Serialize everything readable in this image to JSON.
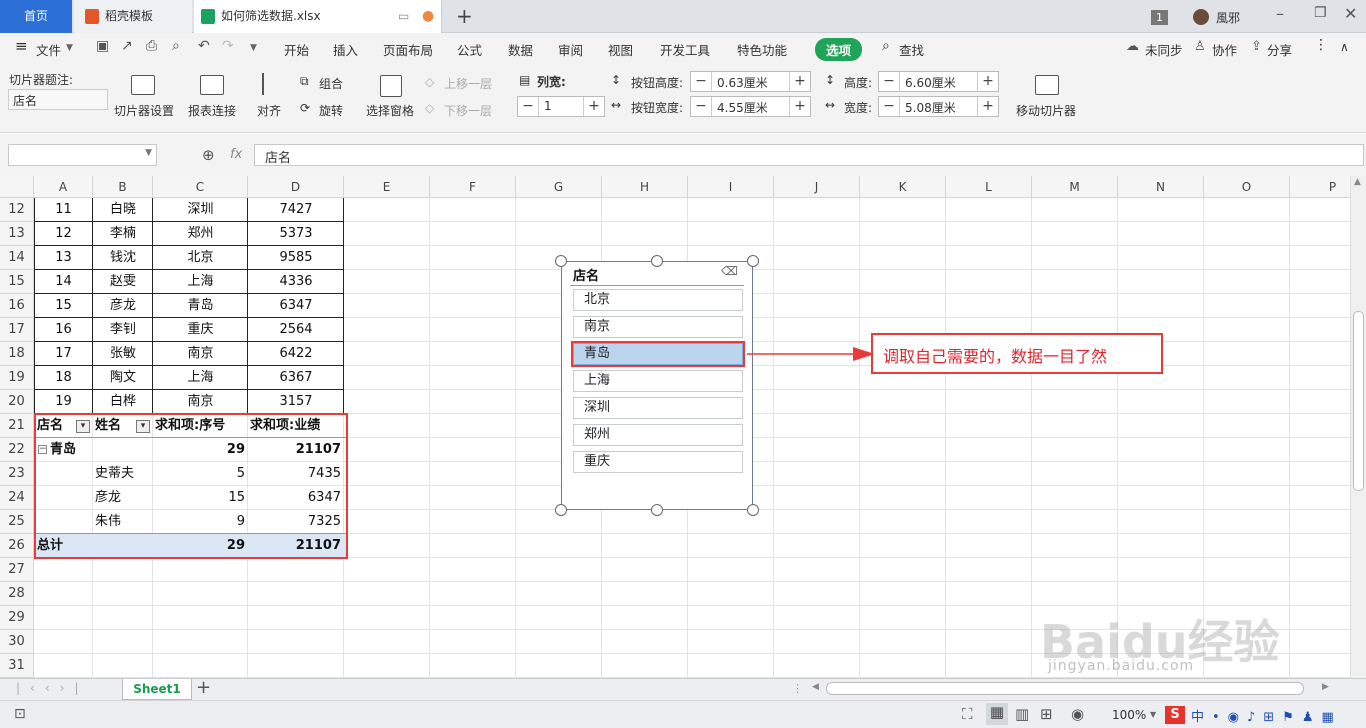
{
  "tabs": {
    "home": "首页",
    "template": "稻壳模板",
    "file": "如何筛选数据.xlsx",
    "badge": "1",
    "user": "風邪"
  },
  "menu": {
    "file": "文件",
    "items": [
      "开始",
      "插入",
      "页面布局",
      "公式",
      "数据",
      "审阅",
      "视图",
      "开发工具",
      "特色功能"
    ],
    "active": "选项",
    "search": "查找",
    "sync": "未同步",
    "collab": "协作",
    "share": "分享"
  },
  "ribbon": {
    "caption_label": "切片器题注:",
    "caption_value": "店名",
    "slicer_settings": "切片器设置",
    "report_conn": "报表连接",
    "align": "对齐",
    "group": "组合",
    "rotate": "旋转",
    "selection_pane": "选择窗格",
    "bring_forward": "上移一层",
    "send_backward": "下移一层",
    "columns_label": "列宽:",
    "columns_value": "1",
    "btn_height_label": "按钮高度:",
    "btn_height_value": "0.63厘米",
    "btn_width_label": "按钮宽度:",
    "btn_width_value": "4.55厘米",
    "height_label": "高度:",
    "height_value": "6.60厘米",
    "width_label": "宽度:",
    "width_value": "5.08厘米",
    "move_slicer": "移动切片器"
  },
  "formula": {
    "fx": "fx",
    "content": "店名"
  },
  "columns": [
    "A",
    "B",
    "C",
    "D",
    "E",
    "F",
    "G",
    "H",
    "I",
    "J",
    "K",
    "L",
    "M",
    "N",
    "O",
    "P"
  ],
  "rows": [
    "12",
    "13",
    "14",
    "15",
    "16",
    "17",
    "18",
    "19",
    "20",
    "21",
    "22",
    "23",
    "24",
    "25",
    "26",
    "27",
    "28",
    "29",
    "30",
    "31"
  ],
  "data_rows": [
    [
      "11",
      "白晓",
      "深圳",
      "7427"
    ],
    [
      "12",
      "李楠",
      "郑州",
      "5373"
    ],
    [
      "13",
      "钱沈",
      "北京",
      "9585"
    ],
    [
      "14",
      "赵雯",
      "上海",
      "4336"
    ],
    [
      "15",
      "彦龙",
      "青岛",
      "6347"
    ],
    [
      "16",
      "李钊",
      "重庆",
      "2564"
    ],
    [
      "17",
      "张敏",
      "南京",
      "6422"
    ],
    [
      "18",
      "陶文",
      "上海",
      "6367"
    ],
    [
      "19",
      "白桦",
      "南京",
      "3157"
    ]
  ],
  "pivot": {
    "headers": [
      "店名",
      "姓名",
      "求和项:序号",
      "求和项:业绩"
    ],
    "group": {
      "name": "青岛",
      "seq": "29",
      "perf": "21107"
    },
    "items": [
      [
        "史蒂夫",
        "5",
        "7435"
      ],
      [
        "彦龙",
        "15",
        "6347"
      ],
      [
        "朱伟",
        "9",
        "7325"
      ]
    ],
    "total": {
      "label": "总计",
      "seq": "29",
      "perf": "21107"
    }
  },
  "slicer": {
    "title": "店名",
    "items": [
      "北京",
      "南京",
      "青岛",
      "上海",
      "深圳",
      "郑州",
      "重庆"
    ],
    "selected": "青岛"
  },
  "annotation": "调取自己需要的，数据一目了然",
  "sheet_tab": "Sheet1",
  "zoom": "100%",
  "watermark": {
    "brand": "Baidu经验",
    "url": "jingyan.baidu.com"
  }
}
